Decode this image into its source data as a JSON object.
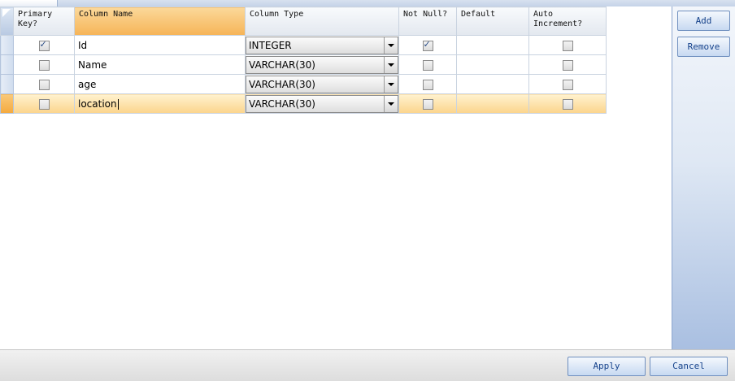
{
  "columns": {
    "primary_key": "Primary\nKey?",
    "column_name": "Column Name",
    "column_type": "Column Type",
    "not_null": "Not Null?",
    "default": "Default",
    "auto_increment": "Auto\nIncrement?"
  },
  "rows": [
    {
      "primary_key": true,
      "name": "Id",
      "type": "INTEGER",
      "not_null": true,
      "default": "",
      "auto_increment": false
    },
    {
      "primary_key": false,
      "name": "Name",
      "type": "VARCHAR(30)",
      "not_null": false,
      "default": "",
      "auto_increment": false
    },
    {
      "primary_key": false,
      "name": "age",
      "type": "VARCHAR(30)",
      "not_null": false,
      "default": "",
      "auto_increment": false
    },
    {
      "primary_key": false,
      "name": "location",
      "type": "VARCHAR(30)",
      "not_null": false,
      "default": "",
      "auto_increment": false
    }
  ],
  "side_buttons": {
    "add": "Add",
    "remove": "Remove"
  },
  "footer_buttons": {
    "apply": "Apply",
    "cancel": "Cancel"
  },
  "colors": {
    "selection": "#f6b457",
    "accent": "#15428b"
  },
  "icons": [
    "checkbox-icon",
    "dropdown-arrow-icon",
    "select-all-corner-icon"
  ]
}
